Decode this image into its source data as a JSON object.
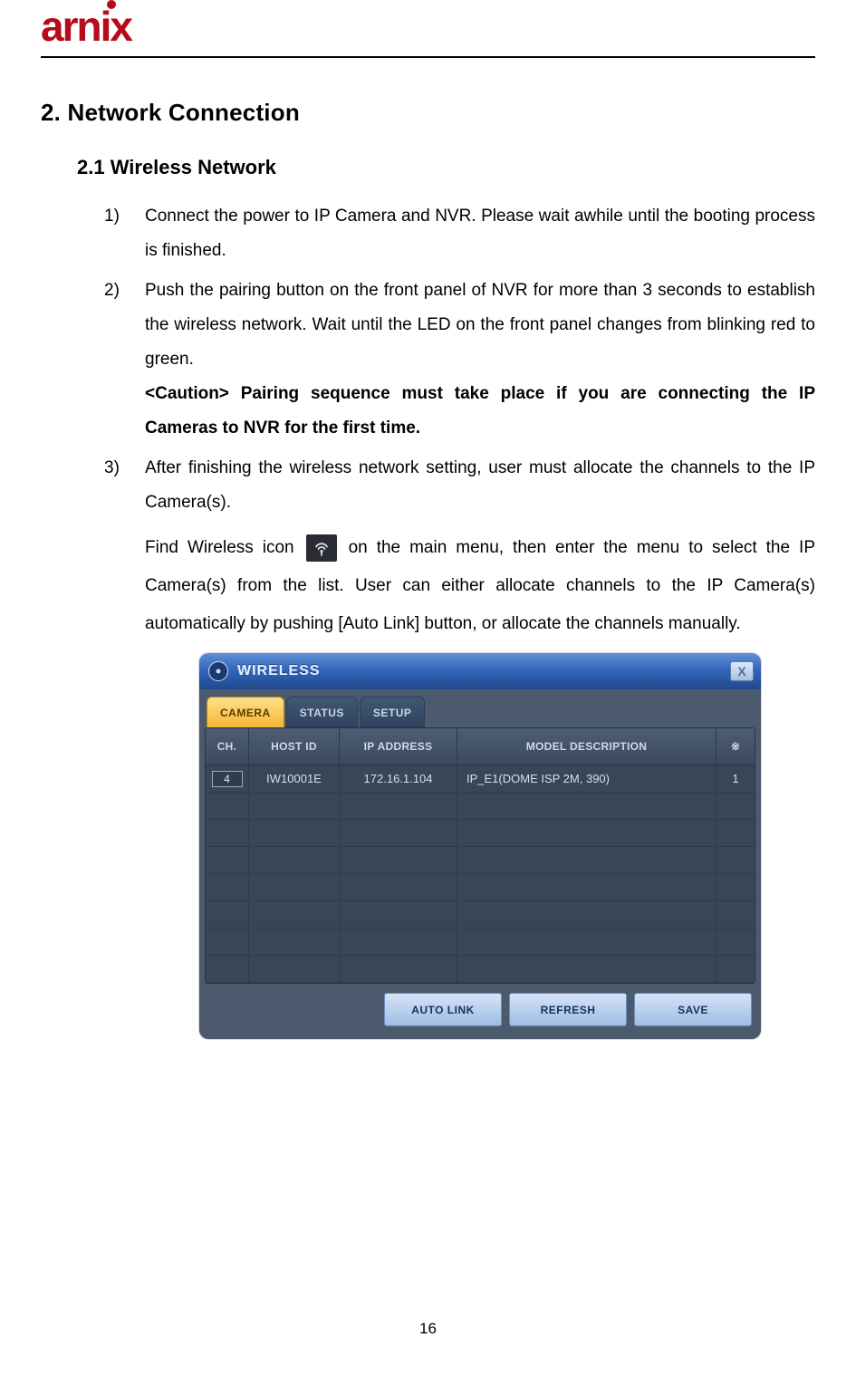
{
  "logo_text": "arnix",
  "section_title": "2. Network Connection",
  "sub_title": "2.1  Wireless Network",
  "steps": {
    "s1": {
      "num": "1)",
      "text": "Connect the power to IP Camera and NVR.  Please wait awhile until the booting process is finished."
    },
    "s2": {
      "num": "2)",
      "text": "Push the pairing button on the front panel of NVR for more than 3 seconds to establish the wireless network.  Wait until the LED on the front panel changes from blinking red to green.",
      "caution": "<Caution> Pairing sequence must take place if you are connecting the IP Cameras to NVR for the first time."
    },
    "s3": {
      "num": "3)",
      "text": "After finishing the wireless network setting, user must allocate the channels to the IP Camera(s).",
      "p2_a": "Find Wireless icon",
      "p2_b": "on the main menu, then enter the menu to select the IP Camera(s) from the list.  User can either allocate channels to the IP Camera(s) automatically by pushing [Auto Link] button, or allocate the channels manually."
    }
  },
  "dialog": {
    "title": "WIRELESS",
    "close": "X",
    "tabs": {
      "camera": "CAMERA",
      "status": "STATUS",
      "setup": "SETUP"
    },
    "columns": {
      "ch": "CH.",
      "host": "HOST ID",
      "ip": "IP ADDRESS",
      "model": "MODEL DESCRIPTION",
      "mark": "※"
    },
    "row1": {
      "ch": "4",
      "host": "IW10001E",
      "ip": "172.16.1.104",
      "model": "IP_E1(DOME ISP 2M, 390)",
      "mark": "1"
    },
    "buttons": {
      "autolink": "AUTO LINK",
      "refresh": "REFRESH",
      "save": "SAVE"
    }
  },
  "page_number": "16"
}
